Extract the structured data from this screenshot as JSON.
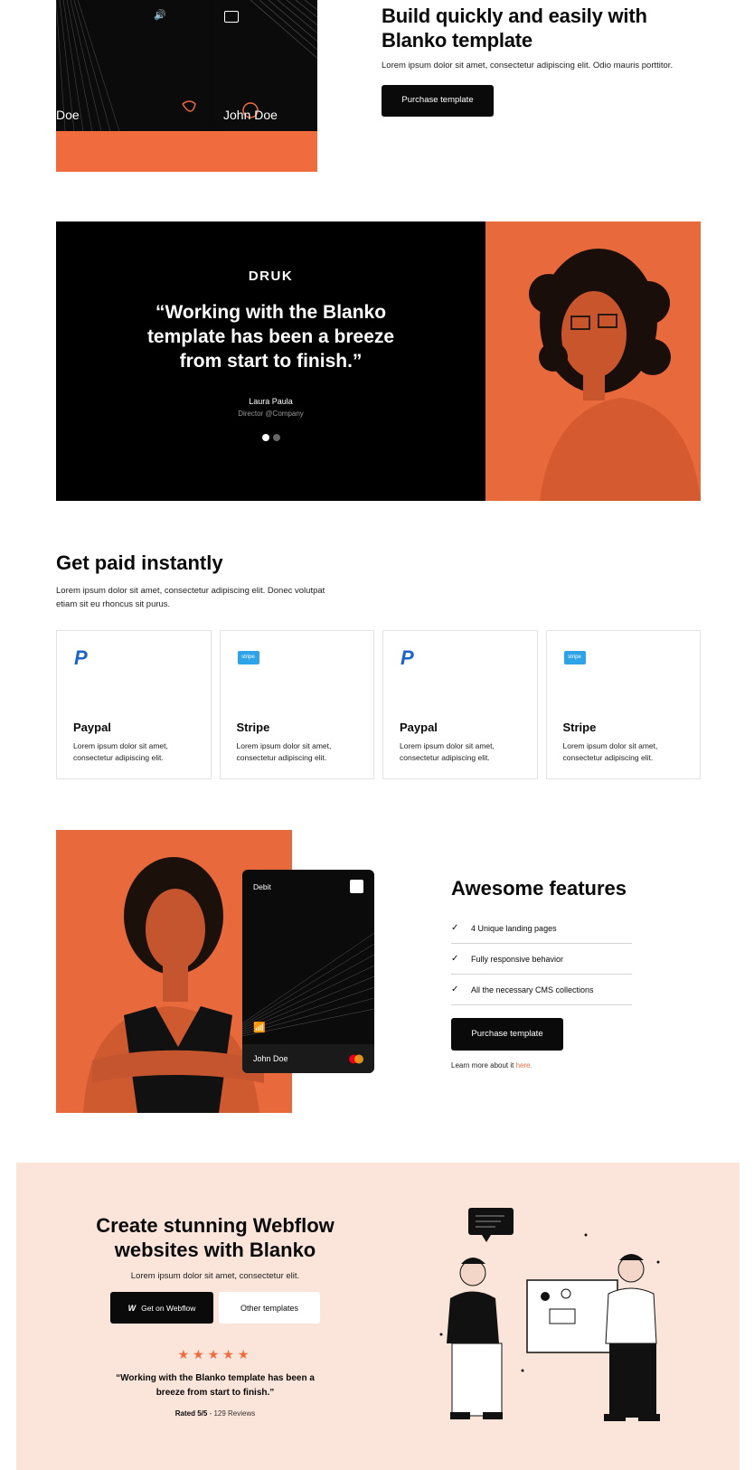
{
  "hero": {
    "card_left_name": "Doe",
    "card_right_name": "John Doe",
    "title": "Build quickly and easily with Blanko template",
    "description": "Lorem ipsum dolor sit amet, consectetur adipiscing elit. Odio mauris porttitor.",
    "button_label": "Purchase template"
  },
  "testimonial": {
    "logo": "DRUK",
    "quote": "“Working with the Blanko template has been a breeze from start to finish.”",
    "author": "Laura Paula",
    "role": "Director @Company",
    "slide_count": 2,
    "active_slide": 1
  },
  "payments": {
    "title": "Get paid instantly",
    "description": "Lorem ipsum dolor sit amet, consectetur adipiscing elit. Donec volutpat etiam sit eu rhoncus sit purus.",
    "cards": [
      {
        "name": "Paypal",
        "icon": "paypal-icon",
        "text": "Lorem ipsum dolor sit amet, consectetur adipiscing elit."
      },
      {
        "name": "Stripe",
        "icon": "stripe-icon",
        "logo_text": "stripe",
        "text": "Lorem ipsum dolor sit amet, consectetur adipiscing elit."
      },
      {
        "name": "Paypal",
        "icon": "paypal-icon",
        "text": "Lorem ipsum dolor sit amet, consectetur adipiscing elit."
      },
      {
        "name": "Stripe",
        "icon": "stripe-icon",
        "logo_text": "stripe",
        "text": "Lorem ipsum dolor sit amet, consectetur adipiscing elit."
      }
    ]
  },
  "features": {
    "card_label": "Debit",
    "card_holder": "John Doe",
    "title": "Awesome features",
    "items": [
      "4 Unique landing pages",
      "Fully responsive behavior",
      "All the necessary CMS collections"
    ],
    "button_label": "Purchase template",
    "learn_more": "Learn more about it",
    "learn_more_link": "here."
  },
  "cta": {
    "title": "Create stunning Webflow websites with Blanko",
    "description": "Lorem ipsum dolor sit amet, consectetur elit.",
    "primary_button": "Get on Webflow",
    "primary_icon_text": "W",
    "secondary_button": "Other templates",
    "stars": "★★★★★",
    "rating": 5,
    "quote": "“Working with the Blanko template has been a breeze from start to finish.”",
    "rated_label": "Rated 5/5",
    "reviews": "- 129 Reviews"
  },
  "colors": {
    "accent": "#f06c3e",
    "dark": "#0a0a0a",
    "cta_bg": "#fbe4d9",
    "paypal": "#1a65c7",
    "stripe": "#2ea3e8"
  }
}
